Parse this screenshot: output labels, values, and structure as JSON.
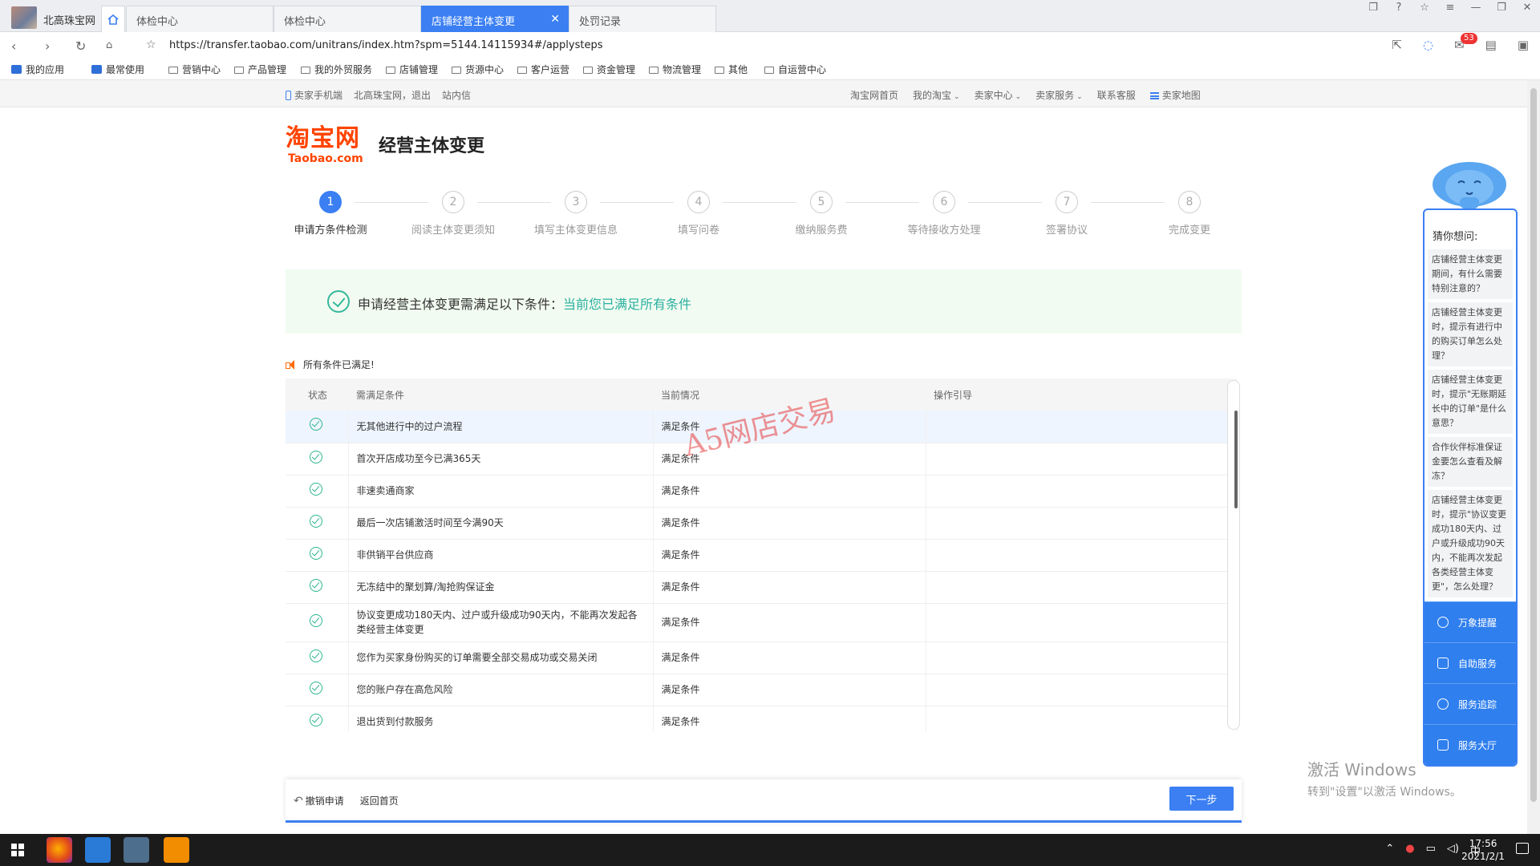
{
  "browser": {
    "profile_label": "北高珠宝网",
    "tabs": [
      {
        "label": "体检中心",
        "active": false
      },
      {
        "label": "体检中心",
        "active": false
      },
      {
        "label": "店铺经营主体变更",
        "active": true
      },
      {
        "label": "处罚记录",
        "active": false
      }
    ],
    "url": "https://transfer.taobao.com/unitrans/index.htm?spm=5144.14115934#/applysteps",
    "mail_badge": "53",
    "bookmarks": [
      "我的应用",
      "最常使用",
      "营销中心",
      "产品管理",
      "我的外贸服务",
      "店铺管理",
      "货源中心",
      "客户运营",
      "资金管理",
      "物流管理",
      "其他",
      "自运营中心"
    ]
  },
  "sitebar": {
    "left": [
      "卖家手机端",
      "北高珠宝网，退出",
      "站内信"
    ],
    "right": [
      "淘宝网首页",
      "我的淘宝",
      "卖家中心",
      "卖家服务",
      "联系客服",
      "卖家地图"
    ]
  },
  "header": {
    "logo_cn": "淘宝网",
    "logo_en": "Taobao.com",
    "title": "经营主体变更"
  },
  "steps": [
    {
      "num": "1",
      "label": "申请方条件检测",
      "active": true
    },
    {
      "num": "2",
      "label": "阅读主体变更须知",
      "active": false
    },
    {
      "num": "3",
      "label": "填写主体变更信息",
      "active": false
    },
    {
      "num": "4",
      "label": "填写问卷",
      "active": false
    },
    {
      "num": "5",
      "label": "缴纳服务费",
      "active": false
    },
    {
      "num": "6",
      "label": "等待接收方处理",
      "active": false
    },
    {
      "num": "7",
      "label": "签署协议",
      "active": false
    },
    {
      "num": "8",
      "label": "完成变更",
      "active": false
    }
  ],
  "notice": {
    "text": "申请经营主体变更需满足以下条件：",
    "link": "当前您已满足所有条件"
  },
  "all_met": "所有条件已满足!",
  "table": {
    "headers": [
      "状态",
      "需满足条件",
      "当前情况",
      "操作引导"
    ],
    "rows": [
      {
        "condition": "无其他进行中的过户流程",
        "status": "满足条件"
      },
      {
        "condition": "首次开店成功至今已满365天",
        "status": "满足条件"
      },
      {
        "condition": "非速卖通商家",
        "status": "满足条件"
      },
      {
        "condition": "最后一次店铺激活时间至今满90天",
        "status": "满足条件"
      },
      {
        "condition": "非供销平台供应商",
        "status": "满足条件"
      },
      {
        "condition": "无冻结中的聚划算/淘抢购保证金",
        "status": "满足条件"
      },
      {
        "condition": "协议变更成功180天内、过户或升级成功90天内，不能再次发起各类经营主体变更",
        "status": "满足条件"
      },
      {
        "condition": "您作为买家身份购买的订单需要全部交易成功或交易关闭",
        "status": "满足条件"
      },
      {
        "condition": "您的账户存在高危风险",
        "status": "满足条件"
      },
      {
        "condition": "退出货到付款服务",
        "status": "满足条件"
      }
    ]
  },
  "watermark": "A5网店交易",
  "footer": {
    "cancel": "撤销申请",
    "back_home": "返回首页",
    "next": "下一步"
  },
  "help": {
    "title": "猜你想问:",
    "questions": [
      "店铺经营主体变更期间，有什么需要特别注意的？",
      "店铺经营主体变更时，提示有进行中的购买订单怎么处理？",
      "店铺经营主体变更时，提示\"无账期延长中的订单\"是什么意思？",
      "合作伙伴标准保证金要怎么查看及解冻？",
      "店铺经营主体变更时，提示\"协议变更成功180天内、过户或升级成功90天内，不能再次发起各类经营主体变更\"，怎么处理？"
    ],
    "actions": [
      "万象提醒",
      "自助服务",
      "服务追踪",
      "服务大厅"
    ]
  },
  "activate": {
    "line1": "激活 Windows",
    "line2": "转到\"设置\"以激活 Windows。"
  },
  "taskbar": {
    "ime": "中",
    "time": "17:56",
    "date": "2021/2/1"
  }
}
